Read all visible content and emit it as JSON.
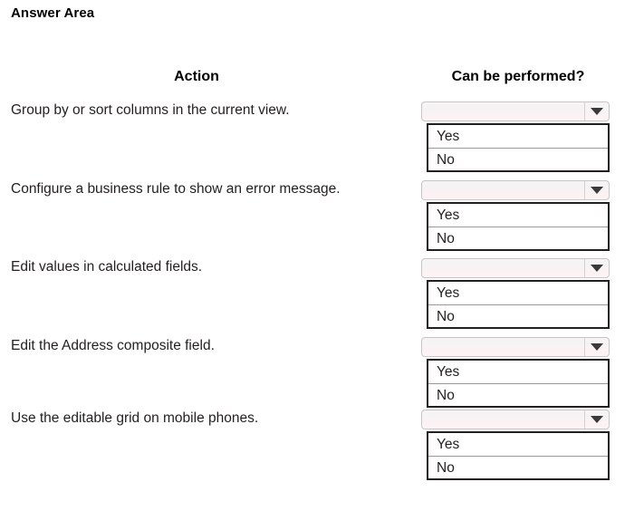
{
  "page": {
    "title": "Answer Area",
    "background_color": "#ffffff",
    "text_color": "#231f20"
  },
  "table": {
    "headers": {
      "action": "Action",
      "can_be_performed": "Can be performed?"
    },
    "rows": [
      {
        "action": "Group by or sort columns in the current view.",
        "dropdown": {
          "selected": "",
          "placeholder": "",
          "expanded": true,
          "options": [
            "Yes",
            "No"
          ]
        }
      },
      {
        "action": "Configure a business rule to show an error message.",
        "dropdown": {
          "selected": "",
          "placeholder": "",
          "expanded": true,
          "options": [
            "Yes",
            "No"
          ]
        }
      },
      {
        "action": "Edit values in calculated fields.",
        "dropdown": {
          "selected": "",
          "placeholder": "",
          "expanded": true,
          "options": [
            "Yes",
            "No"
          ]
        }
      },
      {
        "action": "Edit the Address composite field.",
        "dropdown": {
          "selected": "",
          "placeholder": "",
          "expanded": true,
          "options": [
            "Yes",
            "No"
          ]
        }
      },
      {
        "action": "Use the editable grid on mobile phones.",
        "dropdown": {
          "selected": "",
          "placeholder": "",
          "expanded": true,
          "options": [
            "Yes",
            "No"
          ]
        }
      }
    ]
  },
  "icons": {
    "dropdown_arrow": "chevron-down-icon"
  },
  "colors": {
    "combo_border": "#c9c4c6",
    "combo_fill": "#f8f3f4",
    "list_border": "#231f20",
    "list_divider": "#9a9a9a",
    "arrow": "#3a3a3a"
  }
}
